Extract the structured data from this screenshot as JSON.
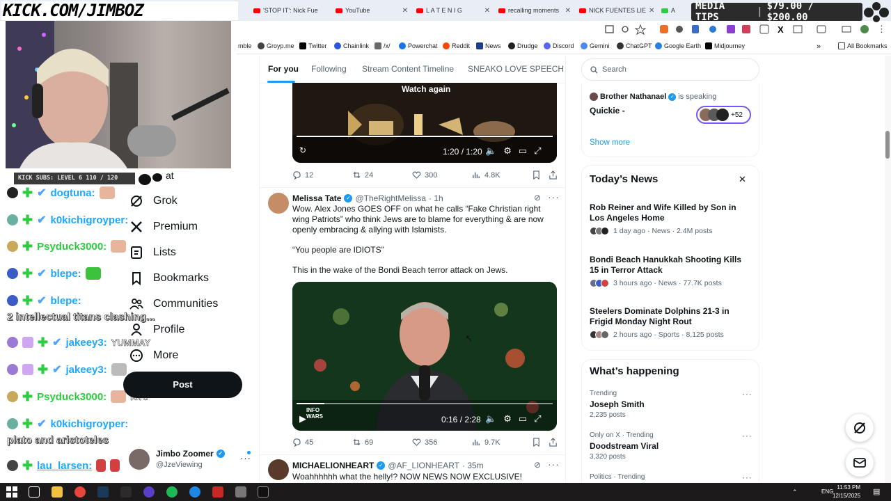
{
  "browser": {
    "tabs": [
      {
        "label": "'STOP IT': Nick Fue"
      },
      {
        "label": "YouTube"
      },
      {
        "label": "L A T E   N I G"
      },
      {
        "label": "recalling moments"
      },
      {
        "label": "NICK FUENTES LIE"
      },
      {
        "label": "A"
      }
    ],
    "bookmarks": [
      "mble",
      "Groyp.me",
      "Twitter",
      "Chainlink",
      "/x/",
      "Powerchat",
      "Reddit",
      "News",
      "Drudge",
      "Discord",
      "Gemini",
      "ChatGPT",
      "Google Earth",
      "Midjourney"
    ],
    "all_bookmarks": "All Bookmarks"
  },
  "stream": {
    "kick_url": "KICK.COM/JIMBOZ",
    "media_tips_label": "MEDIA TIPS",
    "media_tips_value": "$79.00 / $200.00",
    "kick_subs": "KICK SUBS: LEVEL 6 110 / 120",
    "chat": [
      {
        "name": "dogtuna:",
        "color": "#1ea7ff"
      },
      {
        "name": "k0kichigroyper:",
        "color": "#1ea7ff"
      },
      {
        "name": "Psyduck3000:",
        "color": "#2ecc40"
      },
      {
        "name": "blepe:",
        "color": "#1ea7ff"
      },
      {
        "name": "blepe:",
        "color": "#1ea7ff"
      },
      {
        "name": "jakeey3:",
        "color": "#1ea7ff"
      },
      {
        "name": "jakeey3:",
        "color": "#1ea7ff"
      },
      {
        "name": "Psyduck3000:",
        "color": "#2ecc40"
      },
      {
        "name": "k0kichigroyper:",
        "color": "#1ea7ff"
      },
      {
        "name": "lau_larsen:",
        "color": "#1ea7ff"
      }
    ],
    "messages": {
      "blepe2": "2 intellectual titans clashing...",
      "jakeey1": "YUMMAY",
      "psyduck2": "lore",
      "kokichi2": "plato and aristoteles"
    }
  },
  "x_nav": {
    "items": [
      {
        "label": "at"
      },
      {
        "label": "Grok"
      },
      {
        "label": "Premium"
      },
      {
        "label": "Lists"
      },
      {
        "label": "Bookmarks"
      },
      {
        "label": "Communities"
      },
      {
        "label": "Profile"
      },
      {
        "label": "More"
      }
    ],
    "post_label": "Post",
    "user_name": "Jimbo Zoomer",
    "user_handle": "@JzeViewing"
  },
  "feed": {
    "tabs": [
      "For you",
      "Following",
      "Stream Content Timeline",
      "SNEAKO LOVE SPEECH"
    ],
    "video1": {
      "overlay": "Watch again",
      "time": "1:20 / 1:20"
    },
    "tweet0_stats": {
      "replies": "12",
      "reposts": "24",
      "likes": "300",
      "views": "4.8K"
    },
    "tweet1": {
      "author": "Melissa Tate",
      "handle": "@TheRightMelissa",
      "time": "· 1h",
      "text1": "Wow. Alex Jones GOES OFF on what he calls “Fake Christian right wing Patriots” who think Jews are to blame for everything & are now openly embracing & allying with Islamists.",
      "text2": "“You people are IDIOTS”",
      "text3": "This in the wake of the Bondi Beach terror attack on Jews.",
      "video_time": "0:16 / 2:28",
      "video_logo": "INFO WARS",
      "replies": "45",
      "reposts": "69",
      "likes": "356",
      "views": "9.7K"
    },
    "tweet2": {
      "author": "MICHAELIONHEART",
      "handle": "@AF_LIONHEART",
      "time": "· 35m",
      "text": "Woahhhhhh what the helly!? NOW NEWS NOW EXCLUSIVE!"
    }
  },
  "sidebar": {
    "search_placeholder": "Search",
    "space": {
      "host": "Brother Nathanael",
      "status": "is speaking",
      "title": "Quickie -",
      "count": "+52"
    },
    "show_more": "Show more",
    "news_heading": "Today’s News",
    "news": [
      {
        "title": "Rob Reiner and Wife Killed by Son in Los Angeles Home",
        "meta": "1 day ago · News · 2.4M posts"
      },
      {
        "title": "Bondi Beach Hanukkah Shooting Kills 15 in Terror Attack",
        "meta": "3 hours ago · News · 77.7K posts"
      },
      {
        "title": "Steelers Dominate Dolphins 21-3 in Frigid Monday Night Rout",
        "meta": "2 hours ago · Sports · 8,125 posts"
      }
    ],
    "happening_heading": "What’s happening",
    "trends": [
      {
        "category": "Trending",
        "name": "Joseph Smith",
        "count": "2,235 posts"
      },
      {
        "category": "Only on X · Trending",
        "name": "Doodstream Viral",
        "count": "3,320 posts"
      },
      {
        "category": "Politics · Trending",
        "name": "",
        "count": ""
      }
    ]
  },
  "taskbar": {
    "lang": "ENG",
    "time": "11:53 PM",
    "date": "12/15/2025"
  }
}
